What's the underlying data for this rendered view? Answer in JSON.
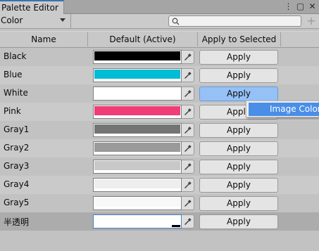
{
  "window": {
    "tab_title": "Palette Editor",
    "menu_icon": "kebab-menu-icon",
    "maximize_icon": "maximize-icon",
    "close_icon": "close-icon"
  },
  "toolbar": {
    "mode_value": "Color",
    "search_placeholder": "",
    "add_label": "+"
  },
  "table": {
    "columns": [
      "Name",
      "Default (Active)",
      "Apply to Selected"
    ],
    "apply_label": "Apply",
    "rows": [
      {
        "name": "Black",
        "color": "#000000"
      },
      {
        "name": "Blue",
        "color": "#00bcd4"
      },
      {
        "name": "White",
        "color": "#ffffff"
      },
      {
        "name": "Pink",
        "color": "#ef3e77"
      },
      {
        "name": "Gray1",
        "color": "#747474"
      },
      {
        "name": "Gray2",
        "color": "#9a9a9a"
      },
      {
        "name": "Gray3",
        "color": "#c8c8c8"
      },
      {
        "name": "Gray4",
        "color": "#eeeeee"
      },
      {
        "name": "Gray5",
        "color": "#f8f8f8"
      },
      {
        "name": "半透明",
        "color": "#ffffff"
      }
    ]
  },
  "popup": {
    "item_label": "Image Color"
  },
  "colors": {
    "accent": "#4a8ee8",
    "hover_button": "#96c1f7",
    "tab_highlight": "#3a72b0"
  }
}
